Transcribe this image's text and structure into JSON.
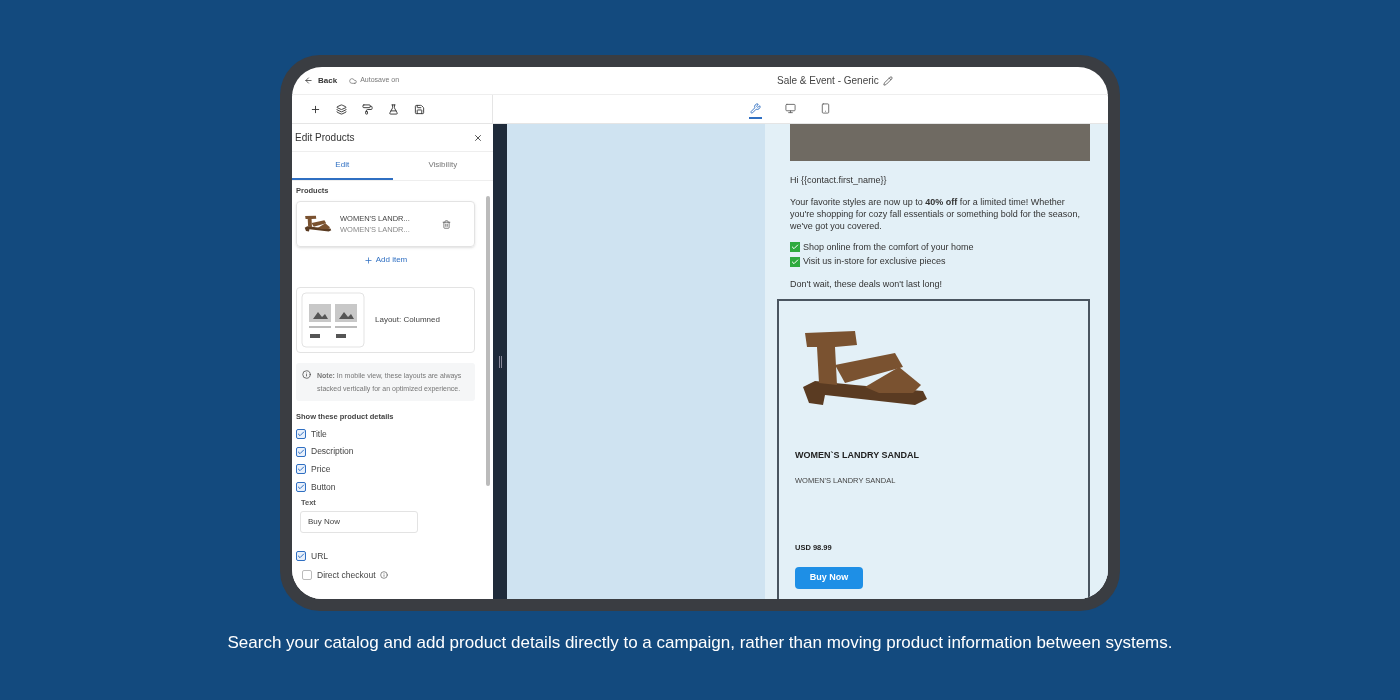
{
  "topbar": {
    "back": "Back",
    "autosave": "Autosave on",
    "title": "Sale & Event - Generic"
  },
  "views": [
    {
      "kind": "tools",
      "selected": true
    },
    {
      "kind": "desktop",
      "selected": false
    },
    {
      "kind": "mobile",
      "selected": false
    }
  ],
  "panel": {
    "title": "Edit Products",
    "tabs": [
      {
        "label": "Edit",
        "selected": true
      },
      {
        "label": "Visibility",
        "selected": false
      }
    ],
    "products_label": "Products",
    "products": [
      {
        "title": "WOMEN'S LANDR...",
        "subtitle": "WOMEN'S LANDR..."
      }
    ],
    "add_item": "Add item",
    "layout": "Layout: Columned",
    "note": "**Note:** In mobile view, these layouts are always stacked vertically for an optimized experience.",
    "details_label": "Show these product details",
    "details": [
      {
        "label": "Title",
        "checked": true
      },
      {
        "label": "Description",
        "checked": true
      },
      {
        "label": "Price",
        "checked": true
      },
      {
        "label": "Button",
        "checked": true
      }
    ],
    "text_label": "Text",
    "text_value": "Buy Now",
    "url": {
      "label": "URL",
      "checked": true
    },
    "direct_checkout": {
      "label": "Direct checkout",
      "checked": false
    }
  },
  "email": {
    "greeting": "Hi {{contact.first_name}}",
    "body": "Your favorite styles are now up to **40% off** for a limited time! Whether you're shopping for cozy fall essentials or something bold for the season, we've got you covered.",
    "bullets": [
      "Shop online from the comfort of your home",
      "Visit us in-store for exclusive pieces"
    ],
    "closing": "Don't wait, these deals won't last long!",
    "product": {
      "title": "WOMEN`S LANDRY SANDAL",
      "description": "WOMEN'S LANDRY SANDAL",
      "price": "USD 98.99",
      "button": "Buy Now"
    }
  },
  "caption": "Search your catalog and add product details directly to a campaign, rather than moving product information between systems."
}
